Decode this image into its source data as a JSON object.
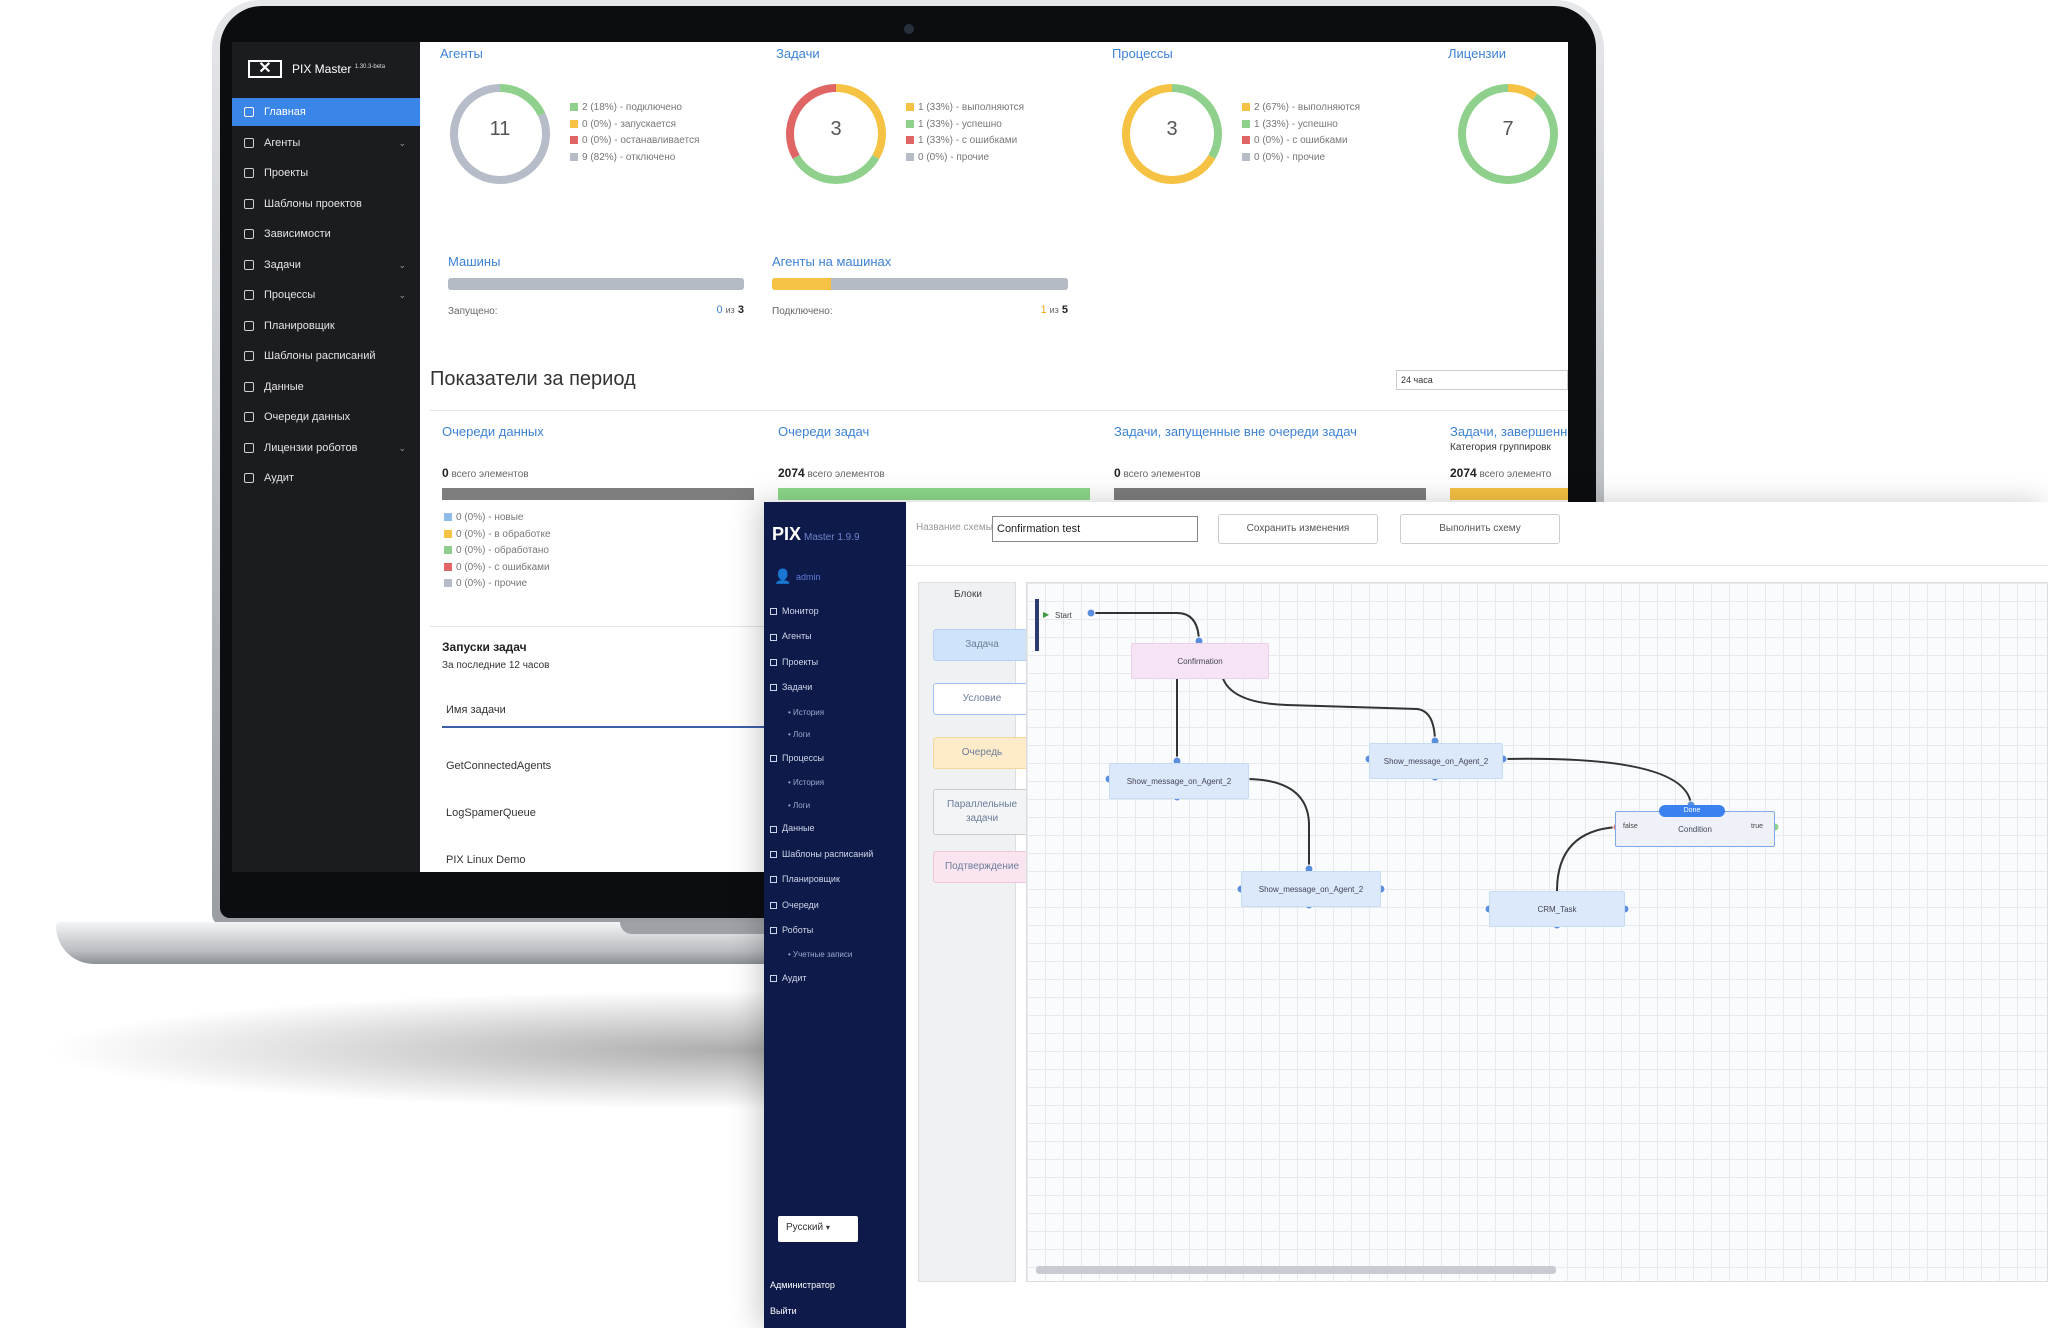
{
  "laptop": {
    "brand": "PIX Master",
    "version": "1.30.3-beta",
    "sidebar": [
      {
        "label": "Главная",
        "icon": "home-icon",
        "active": true
      },
      {
        "label": "Агенты",
        "icon": "monitor-icon",
        "chevron": true
      },
      {
        "label": "Проекты",
        "icon": "project-icon"
      },
      {
        "label": "Шаблоны проектов",
        "icon": "template-icon"
      },
      {
        "label": "Зависимости",
        "icon": "dependency-icon"
      },
      {
        "label": "Задачи",
        "icon": "task-icon",
        "chevron": true
      },
      {
        "label": "Процессы",
        "icon": "process-icon",
        "chevron": true
      },
      {
        "label": "Планировщик",
        "icon": "calendar-icon"
      },
      {
        "label": "Шаблоны расписаний",
        "icon": "schedule-template-icon"
      },
      {
        "label": "Данные",
        "icon": "data-icon"
      },
      {
        "label": "Очереди данных",
        "icon": "queue-icon"
      },
      {
        "label": "Лицензии роботов",
        "icon": "license-icon",
        "chevron": true
      },
      {
        "label": "Аудит",
        "icon": "audit-icon"
      }
    ],
    "summary": [
      {
        "title": "Агенты",
        "total": "11",
        "segments": [
          {
            "color": "#8fd18c",
            "value": 18
          },
          {
            "color": "#b6bdc8",
            "value": 82
          }
        ],
        "legend": [
          {
            "color": "#8fd18c",
            "text": "2 (18%) - подключено"
          },
          {
            "color": "#f5c243",
            "text": "0 (0%) - запускается"
          },
          {
            "color": "#e06666",
            "text": "0 (0%) - останавливается"
          },
          {
            "color": "#b6bdc8",
            "text": "9 (82%) - отключено"
          }
        ]
      },
      {
        "title": "Задачи",
        "total": "3",
        "segments": [
          {
            "color": "#f5c243",
            "value": 33.3
          },
          {
            "color": "#8fd18c",
            "value": 33.3
          },
          {
            "color": "#e06666",
            "value": 33.4
          }
        ],
        "legend": [
          {
            "color": "#f5c243",
            "text": "1 (33%) - выполняются"
          },
          {
            "color": "#8fd18c",
            "text": "1 (33%) - успешно"
          },
          {
            "color": "#e06666",
            "text": "1 (33%) - с ошибками"
          },
          {
            "color": "#b6bdc8",
            "text": "0 (0%) - прочие"
          }
        ]
      },
      {
        "title": "Процессы",
        "total": "3",
        "segments": [
          {
            "color": "#8fd18c",
            "value": 33.3
          },
          {
            "color": "#f5c243",
            "value": 66.7
          }
        ],
        "legend": [
          {
            "color": "#f5c243",
            "text": "2 (67%) - выполняются"
          },
          {
            "color": "#8fd18c",
            "text": "1 (33%) - успешно"
          },
          {
            "color": "#e06666",
            "text": "0 (0%) - с ошибками"
          },
          {
            "color": "#b6bdc8",
            "text": "0 (0%) - прочие"
          }
        ]
      },
      {
        "title": "Лицензии",
        "total": "7",
        "segments": [
          {
            "color": "#f5c243",
            "value": 10
          },
          {
            "color": "#8fd18c",
            "value": 90
          }
        ],
        "legend": []
      }
    ],
    "machines": {
      "title": "Машины",
      "label": "Запущено:",
      "value": "0",
      "of": "из",
      "total": "3",
      "fraction": 0
    },
    "agents_on_machines": {
      "title": "Агенты на машинах",
      "label": "Подключено:",
      "value": "1",
      "of": "из",
      "total": "5",
      "fraction": 0.2
    },
    "period_title": "Показатели за период",
    "period_select": "24 часа",
    "period": [
      {
        "title": "Очереди данных",
        "count": "0",
        "count_label": "всего элементов",
        "legend": [
          {
            "color": "#8fbbe8",
            "text": "0 (0%) - новые"
          },
          {
            "color": "#f5c243",
            "text": "0 (0%) - в обработке"
          },
          {
            "color": "#8fd18c",
            "text": "0 (0%) - обработано"
          },
          {
            "color": "#e06666",
            "text": "0 (0%) - с ошибками"
          },
          {
            "color": "#b6bdc8",
            "text": "0 (0%) - прочие"
          }
        ]
      },
      {
        "title": "Очереди задач",
        "count": "2074",
        "count_label": "всего элементов"
      },
      {
        "title": "Задачи, запущенные вне очереди задач",
        "count": "0",
        "count_label": "всего элементов"
      },
      {
        "title": "Задачи, завершенн",
        "subtitle": "Категория группировк",
        "count": "2074",
        "count_label": "всего элементо"
      }
    ],
    "runs": {
      "title": "Запуски задач",
      "subtitle": "За последние 12 часов",
      "column": "Имя задачи",
      "rows": [
        "GetConnectedAgents",
        "LogSpamerQueue",
        "PIX Linux Demo"
      ]
    }
  },
  "editor": {
    "logo": "PIX",
    "version": "Master 1.9.9",
    "user": "admin",
    "menu": [
      {
        "label": "Монитор",
        "sub": false
      },
      {
        "label": "Агенты",
        "sub": false
      },
      {
        "label": "Проекты",
        "sub": false
      },
      {
        "label": "Задачи",
        "sub": false
      },
      {
        "label": "История",
        "sub": true
      },
      {
        "label": "Логи",
        "sub": true
      },
      {
        "label": "Процессы",
        "sub": false
      },
      {
        "label": "История",
        "sub": true
      },
      {
        "label": "Логи",
        "sub": true
      },
      {
        "label": "Данные",
        "sub": false
      },
      {
        "label": "Шаблоны расписаний",
        "sub": false
      },
      {
        "label": "Планировщик",
        "sub": false
      },
      {
        "label": "Очереди",
        "sub": false
      },
      {
        "label": "Роботы",
        "sub": false
      },
      {
        "label": "Учетные записи",
        "sub": true
      },
      {
        "label": "Аудит",
        "sub": false
      }
    ],
    "language": "Русский",
    "footer": [
      "Администратор",
      "Выйти"
    ],
    "schema_label": "Название схемы",
    "schema_name": "Confirmation test",
    "save_button": "Сохранить изменения",
    "run_button": "Выполнить схему",
    "blocks_title": "Блоки",
    "blocks": [
      {
        "label": "Задача",
        "bg": "#cfe3fa",
        "border": "#b4d2f4"
      },
      {
        "label": "Условие",
        "bg": "#ffffff",
        "border": "#9fc3ee"
      },
      {
        "label": "Очередь",
        "bg": "#fdebc9",
        "border": "#f5d79b"
      },
      {
        "label": "Параллельные задачи",
        "bg": "#f3f4f6",
        "border": "#cccccc"
      },
      {
        "label": "Подтверждение",
        "bg": "#f9e4f0",
        "border": "#efc4dc"
      }
    ],
    "nodes": {
      "start": "Start",
      "confirmation": "Confirmation",
      "agent1": "Show_message_on_Agent_2",
      "agent2": "Show_message_on_Agent_2",
      "agent3": "Show_message_on_Agent_2",
      "condition": "Condition",
      "cond_badge": "Done",
      "cond_false": "false",
      "cond_true": "true",
      "crm": "CRM_Task"
    }
  }
}
